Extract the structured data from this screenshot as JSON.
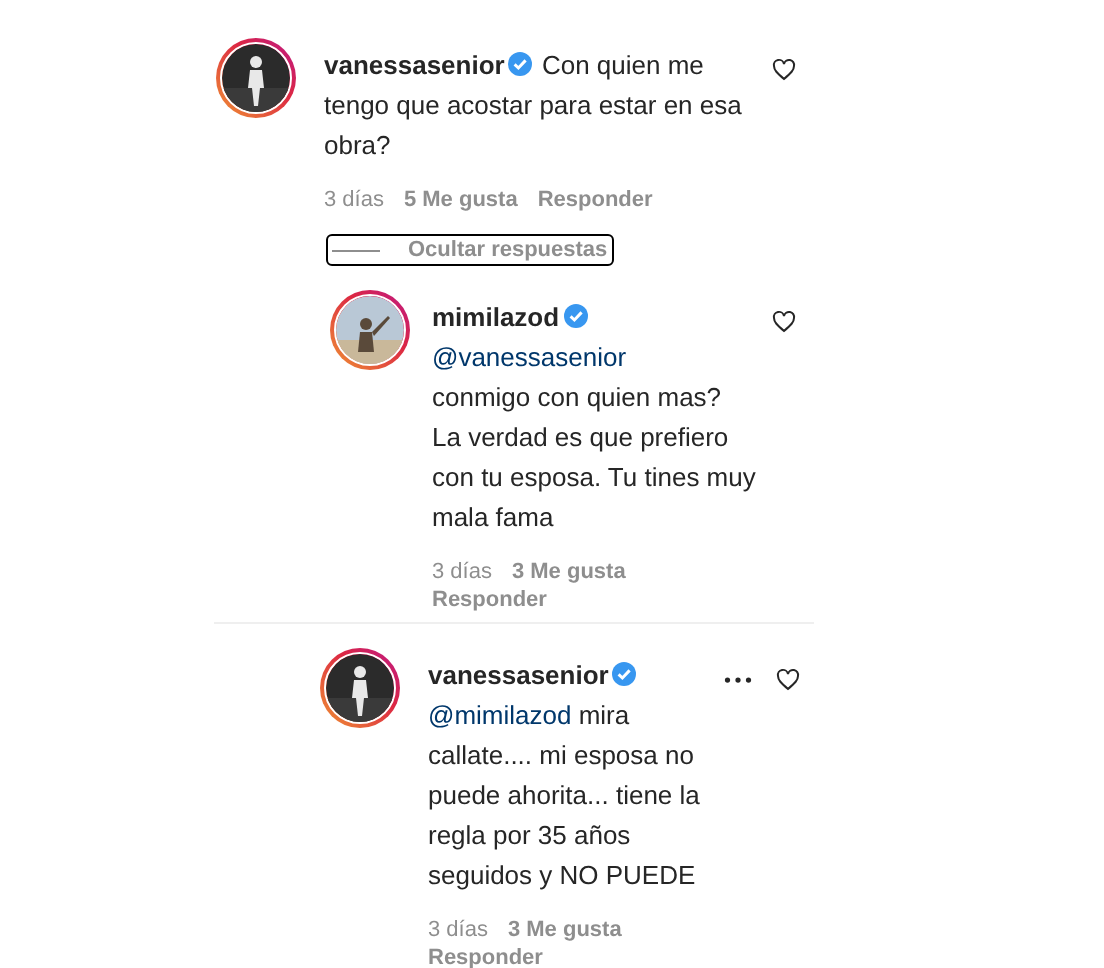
{
  "comments": [
    {
      "username": "vanessasenior",
      "verified": true,
      "text": "Con quien me tengo que acostar para estar en esa obra?",
      "time": "3 días",
      "likes": "5 Me gusta",
      "reply_label": "Responder",
      "liked": false,
      "hide_replies_label": "Ocultar respuestas",
      "focused": true,
      "replies": [
        {
          "username": "mimilazod",
          "verified": true,
          "mention": "@vanessasenior",
          "text": "conmigo con quien mas? La verdad es que prefiero con tu esposa. Tu tines muy mala fama",
          "time": "3 días",
          "likes": "3 Me gusta",
          "reply_label": "Responder",
          "liked": false
        }
      ]
    },
    {
      "username": "vanessasenior",
      "verified": true,
      "mention": "@mimilazod",
      "text": "mira callate.... mi esposa no puede ahorita... tiene la regla por 35 años seguidos y NO PUEDE",
      "time": "3 días",
      "likes": "3 Me gusta",
      "reply_label": "Responder",
      "options_visible": true,
      "liked": false
    }
  ]
}
